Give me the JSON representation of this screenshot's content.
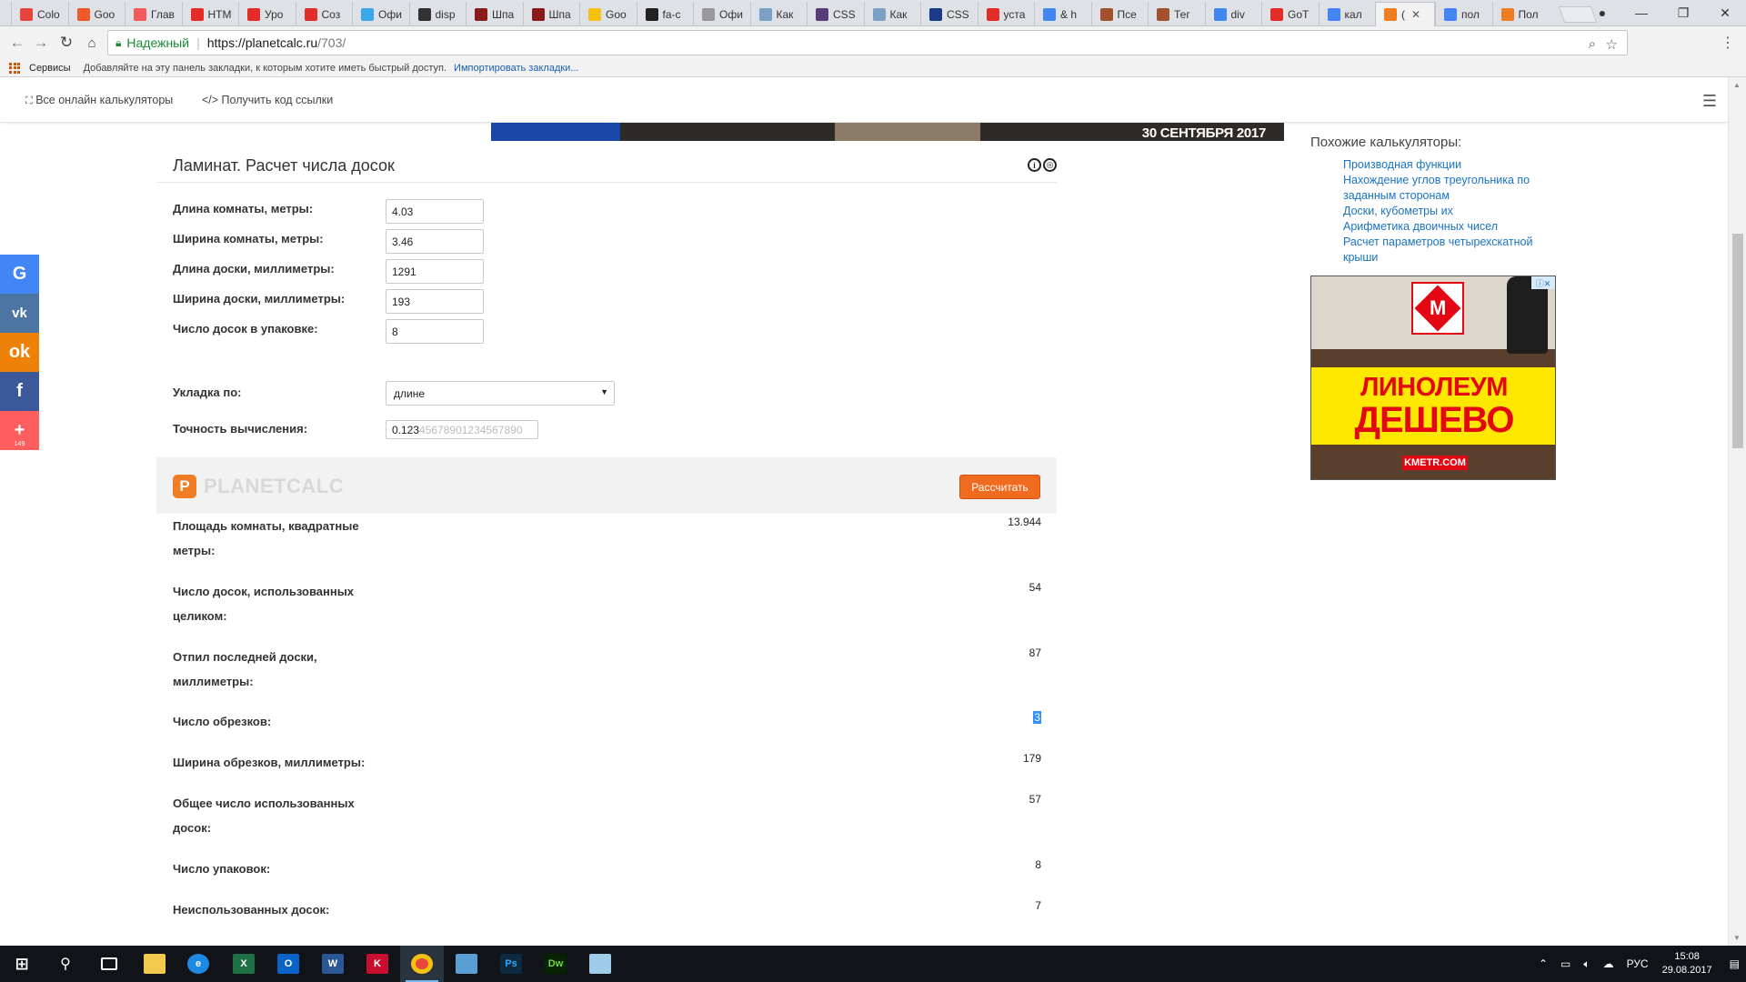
{
  "browser": {
    "tabs": [
      {
        "label": "Colo",
        "color": "#e8453c"
      },
      {
        "label": "Goo",
        "color": "#f05a28"
      },
      {
        "label": "Глав",
        "color": "#f05a5a"
      },
      {
        "label": "HTM",
        "color": "#e52d27"
      },
      {
        "label": "Уро",
        "color": "#e52d27"
      },
      {
        "label": "Соз",
        "color": "#e52d27"
      },
      {
        "label": "Офи",
        "color": "#3aa8e8"
      },
      {
        "label": "disp",
        "color": "#333333"
      },
      {
        "label": "Шпа",
        "color": "#8b1a1a"
      },
      {
        "label": "Шпа",
        "color": "#8b1a1a"
      },
      {
        "label": "Goo",
        "color": "#f4c20d"
      },
      {
        "label": "fa-c",
        "color": "#222222"
      },
      {
        "label": "Офи",
        "color": "#999999"
      },
      {
        "label": "Как",
        "color": "#7aa0c4"
      },
      {
        "label": "CSS",
        "color": "#563d7c"
      },
      {
        "label": "Как",
        "color": "#7aa0c4"
      },
      {
        "label": "CSS",
        "color": "#1a3a8a"
      },
      {
        "label": "уста",
        "color": "#e52d27"
      },
      {
        "label": "& h",
        "color": "#4285f4"
      },
      {
        "label": "Псе",
        "color": "#a0522d"
      },
      {
        "label": "Тег",
        "color": "#a0522d"
      },
      {
        "label": "div",
        "color": "#4285f4"
      },
      {
        "label": "GoT",
        "color": "#e52d27"
      },
      {
        "label": "кал",
        "color": "#4285f4"
      },
      {
        "label": "(",
        "color": "#f07c23",
        "active": true,
        "close": "✕"
      },
      {
        "label": "пол",
        "color": "#4285f4"
      },
      {
        "label": "Пол",
        "color": "#f07c23"
      }
    ],
    "secure_label": "Надежный",
    "url_host": "https://planetcalc.ru",
    "url_path": "/703/",
    "bookmarks": {
      "services": "Сервисы",
      "hint": "Добавляйте на эту панель закладки, к которым хотите иметь быстрый доступ.",
      "import": "Импортировать закладки..."
    }
  },
  "site_nav": {
    "all_calcs": "Все онлайн калькуляторы",
    "get_code": "</> Получить код ссылки"
  },
  "banner": {
    "text": "30 СЕНТЯБРЯ 2017"
  },
  "social": {
    "plus_count": "149"
  },
  "calculator": {
    "title": "Ламинат. Расчет числа досок",
    "fields": [
      {
        "label": "Длина комнаты, метры:",
        "value": "4.03"
      },
      {
        "label": "Ширина комнаты, метры:",
        "value": "3.46"
      },
      {
        "label": "Длина доски, миллиметры:",
        "value": "1291"
      },
      {
        "label": "Ширина доски, миллиметры:",
        "value": "193"
      },
      {
        "label": "Число досок в упаковке:",
        "value": "8"
      }
    ],
    "layout_label": "Укладка по:",
    "layout_value": "длине",
    "precision_label": "Точность вычисления:",
    "precision_selected": "0.123",
    "precision_rest": "45678901234567890",
    "brand": "PLANETCALC",
    "brand_letter": "P",
    "calc_button": "Рассчитать",
    "results": [
      {
        "label": "Площадь комнаты, квадратные метры:",
        "value": "13.944"
      },
      {
        "label": "Число досок, использованных целиком:",
        "value": "54"
      },
      {
        "label": "Отпил последней доски, миллиметры:",
        "value": "87"
      },
      {
        "label": "Число обрезков:",
        "value": "3"
      },
      {
        "label": "Ширина обрезков, миллиметры:",
        "value": "179"
      },
      {
        "label": "Общее число использованных досок:",
        "value": "57"
      },
      {
        "label": "Число упаковок:",
        "value": "8"
      },
      {
        "label": "Неиспользованных досок:",
        "value": "7"
      }
    ]
  },
  "sidebar": {
    "similar_title": "Похожие калькуляторы:",
    "links": [
      "Производная функции",
      "Нахождение углов треугольника по заданным сторонам",
      "Доски, кубометры их",
      "Арифметика двоичных чисел",
      "Расчет параметров четырехскатной крыши"
    ]
  },
  "ad": {
    "line1": "ЛИНОЛЕУМ",
    "line2": "ДЕШЕВО",
    "site": "KMETR.COM",
    "logo_letter": "M"
  },
  "taskbar": {
    "lang": "РУС",
    "time": "15:08",
    "date": "29.08.2017"
  }
}
